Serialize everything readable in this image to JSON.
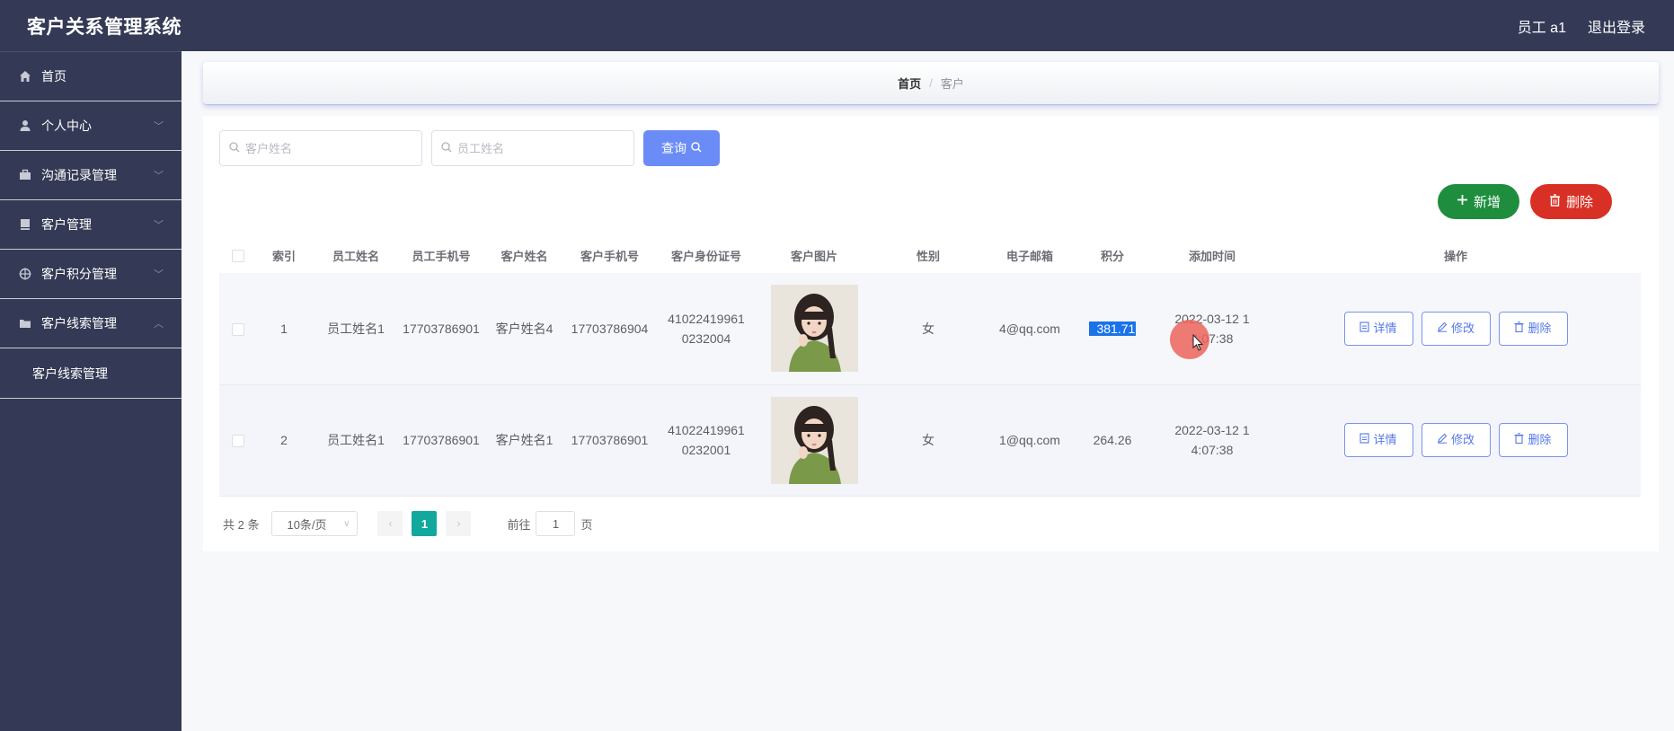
{
  "header": {
    "title": "客户关系管理系统",
    "user": "员工 a1",
    "logout": "退出登录"
  },
  "sidebar": {
    "items": [
      {
        "label": "首页",
        "icon": "home-icon"
      },
      {
        "label": "个人中心",
        "icon": "user-icon"
      },
      {
        "label": "沟通记录管理",
        "icon": "briefcase-icon"
      },
      {
        "label": "客户管理",
        "icon": "document-icon"
      },
      {
        "label": "客户积分管理",
        "icon": "target-icon"
      },
      {
        "label": "客户线索管理",
        "icon": "folder-icon"
      }
    ],
    "subitems": [
      {
        "label": "客户线索管理"
      }
    ]
  },
  "breadcrumb": {
    "home": "首页",
    "separator": "/",
    "current": "客户"
  },
  "search": {
    "customer_placeholder": "客户姓名",
    "employee_placeholder": "员工姓名",
    "button": "查询"
  },
  "actions": {
    "add": "新增",
    "delete": "删除"
  },
  "table": {
    "columns": [
      "索引",
      "员工姓名",
      "员工手机号",
      "客户姓名",
      "客户手机号",
      "客户身份证号",
      "客户图片",
      "性别",
      "电子邮箱",
      "积分",
      "添加时间",
      "操作"
    ],
    "rows": [
      {
        "index": "1",
        "employee_name": "员工姓名1",
        "employee_phone": "17703786901",
        "customer_name": "客户姓名4",
        "customer_phone": "17703786904",
        "id_line1": "41022419961",
        "id_line2": "0232004",
        "gender": "女",
        "email": "4@qq.com",
        "points_hidden": "3",
        "points": "381.71",
        "time_line1": "2022-03-12 1",
        "time_line2": "4:07:38"
      },
      {
        "index": "2",
        "employee_name": "员工姓名1",
        "employee_phone": "17703786901",
        "customer_name": "客户姓名1",
        "customer_phone": "17703786901",
        "id_line1": "41022419961",
        "id_line2": "0232001",
        "gender": "女",
        "email": "1@qq.com",
        "points": "264.26",
        "time_line1": "2022-03-12 1",
        "time_line2": "4:07:38"
      }
    ],
    "row_actions": {
      "detail": "详情",
      "edit": "修改",
      "delete": "删除"
    }
  },
  "pagination": {
    "total": "共 2 条",
    "page_size": "10条/页",
    "current_page": "1",
    "goto_label": "前往",
    "goto_value": "1",
    "page_unit": "页"
  },
  "colors": {
    "primary": "#6b8cf6",
    "add": "#1e8e3e",
    "delete": "#d93025",
    "sidebar": "#343a55",
    "page_active": "#13a89e"
  }
}
